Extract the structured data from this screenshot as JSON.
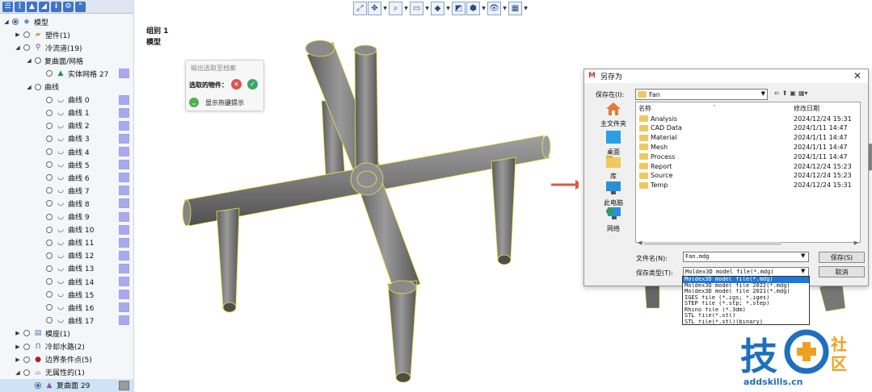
{
  "tree": {
    "items": [
      {
        "label": "模型",
        "level": 0,
        "expanded": true,
        "icon": "model-icon"
      },
      {
        "label": "塑件(1)",
        "level": 1,
        "expanded": false,
        "icon": "part-icon"
      },
      {
        "label": "冷流道(19)",
        "level": 1,
        "expanded": true,
        "icon": "cold-runner-icon"
      },
      {
        "label": "复曲面/网格",
        "level": 2,
        "expanded": true,
        "icon": ""
      },
      {
        "label": "实体网格 27",
        "level": 3,
        "icon": "solid-mesh-icon",
        "swatch": true
      },
      {
        "label": "曲线",
        "level": 2,
        "expanded": true,
        "icon": ""
      },
      {
        "label": "曲线 0",
        "level": 3,
        "icon": "curve-icon",
        "swatch": true
      },
      {
        "label": "曲线 1",
        "level": 3,
        "icon": "curve-icon",
        "swatch": true
      },
      {
        "label": "曲线 2",
        "level": 3,
        "icon": "curve-icon",
        "swatch": true
      },
      {
        "label": "曲线 3",
        "level": 3,
        "icon": "curve-icon",
        "swatch": true
      },
      {
        "label": "曲线 4",
        "level": 3,
        "icon": "curve-icon",
        "swatch": true
      },
      {
        "label": "曲线 5",
        "level": 3,
        "icon": "curve-icon",
        "swatch": true
      },
      {
        "label": "曲线 6",
        "level": 3,
        "icon": "curve-icon",
        "swatch": true
      },
      {
        "label": "曲线 7",
        "level": 3,
        "icon": "curve-icon",
        "swatch": true
      },
      {
        "label": "曲线 8",
        "level": 3,
        "icon": "curve-icon",
        "swatch": true
      },
      {
        "label": "曲线 9",
        "level": 3,
        "icon": "curve-icon",
        "swatch": true
      },
      {
        "label": "曲线 10",
        "level": 3,
        "icon": "curve-icon",
        "swatch": true
      },
      {
        "label": "曲线 11",
        "level": 3,
        "icon": "curve-icon",
        "swatch": true
      },
      {
        "label": "曲线 12",
        "level": 3,
        "icon": "curve-icon",
        "swatch": true
      },
      {
        "label": "曲线 13",
        "level": 3,
        "icon": "curve-icon",
        "swatch": true
      },
      {
        "label": "曲线 14",
        "level": 3,
        "icon": "curve-icon",
        "swatch": true
      },
      {
        "label": "曲线 15",
        "level": 3,
        "icon": "curve-icon",
        "swatch": true
      },
      {
        "label": "曲线 16",
        "level": 3,
        "icon": "curve-icon",
        "swatch": true
      },
      {
        "label": "曲线 17",
        "level": 3,
        "icon": "curve-icon",
        "swatch": true
      },
      {
        "label": "模座(1)",
        "level": 1,
        "expanded": false,
        "icon": "mold-base-icon"
      },
      {
        "label": "冷却水路(2)",
        "level": 1,
        "expanded": false,
        "icon": "cooling-channel-icon"
      },
      {
        "label": "边界条件点(5)",
        "level": 1,
        "expanded": false,
        "icon": "boundary-point-icon"
      },
      {
        "label": "无属性的(1)",
        "level": 1,
        "expanded": true,
        "icon": "no-attribute-icon"
      },
      {
        "label": "复曲面 29",
        "level": 2,
        "icon": "surface-icon",
        "swatch": true,
        "selected": true
      }
    ]
  },
  "viewport": {
    "group_label": "组别 1",
    "model_label": "模型"
  },
  "selection_popup": {
    "title": "输出选取至档案",
    "selected_label": "选取的物件：",
    "hotkey_label": "显示热键提示"
  },
  "save_dialog": {
    "title": "另存为",
    "save_in_label": "保存在(I):",
    "save_in_value": "Fan",
    "places": [
      {
        "label": "主文件夹",
        "icon": "home-folder-icon"
      },
      {
        "label": "桌面",
        "icon": "desktop-icon"
      },
      {
        "label": "库",
        "icon": "library-icon"
      },
      {
        "label": "此电脑",
        "icon": "this-pc-icon"
      },
      {
        "label": "网络",
        "icon": "network-icon"
      }
    ],
    "columns": {
      "name": "名称",
      "modified": "修改日期"
    },
    "files": [
      {
        "name": "Analysis",
        "modified": "2024/12/24 15:31"
      },
      {
        "name": "CAD Data",
        "modified": "2024/1/11 14:47"
      },
      {
        "name": "Material",
        "modified": "2024/1/11 14:47"
      },
      {
        "name": "Mesh",
        "modified": "2024/1/11 14:47"
      },
      {
        "name": "Process",
        "modified": "2024/1/11 14:47"
      },
      {
        "name": "Report",
        "modified": "2024/12/24 15:23"
      },
      {
        "name": "Source",
        "modified": "2024/12/24 15:23"
      },
      {
        "name": "Temp",
        "modified": "2024/12/24 15:31"
      }
    ],
    "filename_label": "文件名(N):",
    "filename_value": "Fan.mdg",
    "filetype_label": "保存类型(T):",
    "filetype_value": "Moldex3D model file(*.mdg)",
    "save_button": "保存(S)",
    "cancel_button": "取消",
    "filetype_options": [
      "Moldex3D model file(*.mdg)",
      "Moldex3D model file 2022(*.mdg)",
      "Moldex3D model file 2021(*.mdg)",
      "IGES file (*.igs; *.iges)",
      "STEP file (*.stp; *.step)",
      "Rhino file (*.3dm)",
      "STL file(*.stl)",
      "STL file(*.stl)(binary)"
    ],
    "filetype_selected_index": 0
  },
  "watermark": {
    "text": "addskills.cn",
    "logo_text": "技术社区"
  },
  "colors": {
    "swatch": "#a9a9f0",
    "pipe": "#6f6f6f",
    "pipe_edge": "#e8e84a",
    "arrow": "#e0554a",
    "selection": "#1e78d7"
  }
}
